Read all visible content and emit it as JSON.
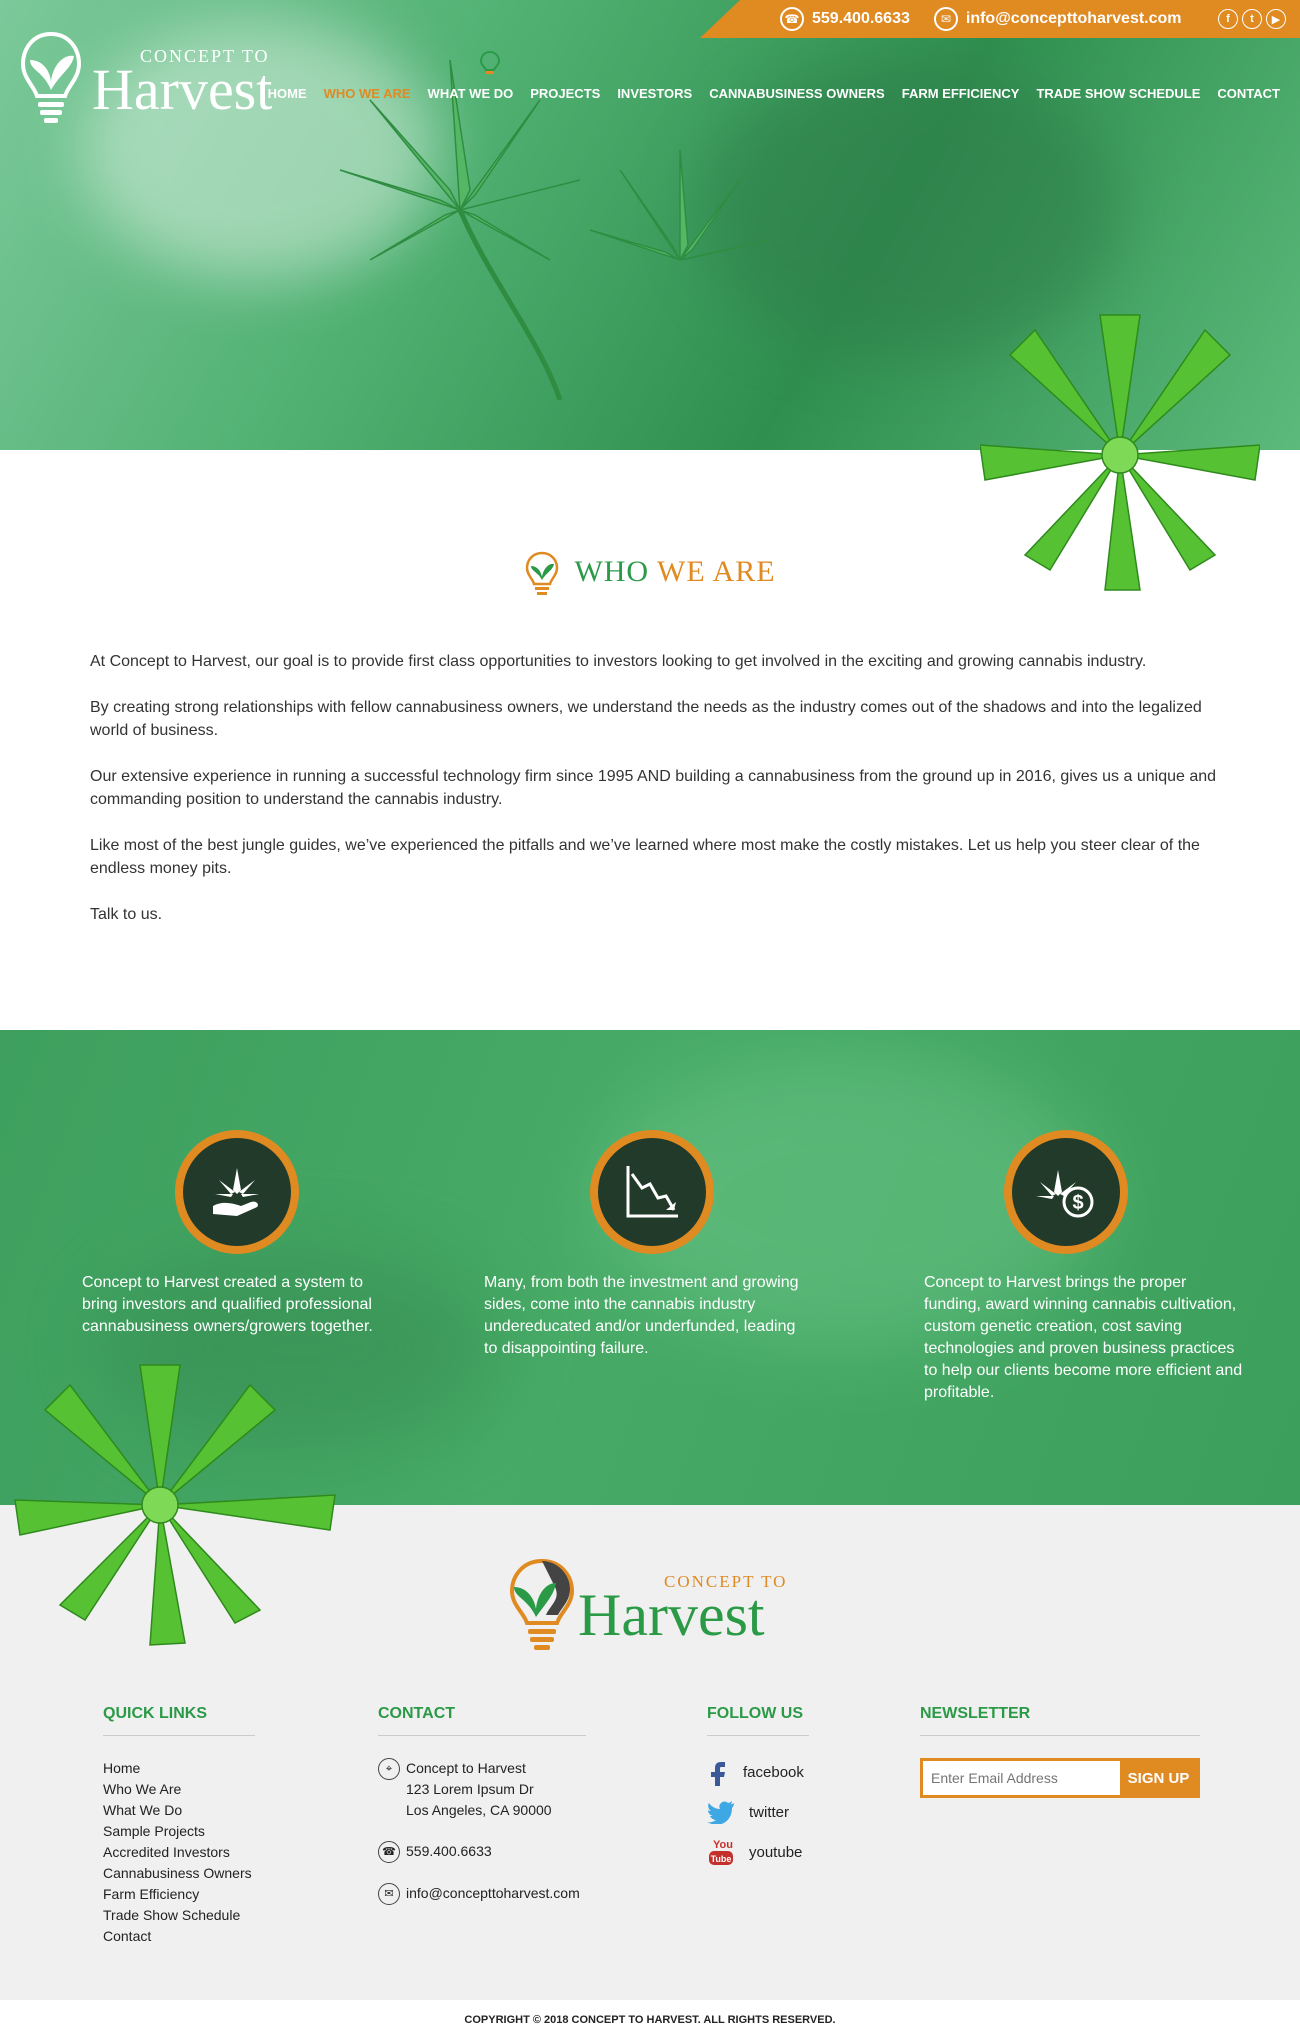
{
  "topbar": {
    "phone": "559.400.6633",
    "email": "info@concepttoharvest.com",
    "social_icons": [
      "facebook-icon",
      "twitter-icon",
      "youtube-icon"
    ]
  },
  "brand": {
    "small": "CONCEPT TO",
    "big": "Harvest"
  },
  "nav": {
    "items": [
      {
        "label": "HOME"
      },
      {
        "label": "WHO WE ARE"
      },
      {
        "label": "WHAT WE DO"
      },
      {
        "label": "PROJECTS"
      },
      {
        "label": "INVESTORS"
      },
      {
        "label": "CANNABUSINESS OWNERS"
      },
      {
        "label": "FARM EFFICIENCY"
      },
      {
        "label": "TRADE SHOW SCHEDULE"
      },
      {
        "label": "CONTACT"
      }
    ],
    "active_index": 1
  },
  "about": {
    "title_a": "WHO ",
    "title_b": "WE ARE",
    "paragraphs": [
      "At Concept to Harvest, our goal is to provide first class opportunities to investors looking to get involved in the exciting and growing cannabis industry.",
      "By creating strong relationships with fellow cannabusiness owners, we understand the needs as the industry comes out of the shadows and into the legalized world of business.",
      "Our extensive experience in running a successful technology firm since 1995 AND building a cannabusiness from the ground up in 2016, gives us a unique and commanding position to understand the cannabis industry.",
      "Like most of the best jungle guides, we’ve experienced the pitfalls and we’ve learned where most make the costly mistakes. Let us help you steer clear of the endless money pits.",
      "Talk to us."
    ]
  },
  "features": [
    {
      "icon": "hand-leaf-icon",
      "text": "Concept to Harvest created a system to bring investors and qualified professional cannabusiness owners/growers together."
    },
    {
      "icon": "declining-chart-icon",
      "text": "Many, from both the investment and growing sides, come into the cannabis industry undereducated and/or underfunded, leading to disappointing failure."
    },
    {
      "icon": "leaf-dollar-icon",
      "text": "Concept to Harvest brings the proper funding, award winning cannabis cultivation, custom genetic creation, cost saving technologies and proven business practices to help our clients become more efficient and profitable."
    }
  ],
  "footer": {
    "quick_links_title": "QUICK LINKS",
    "quick_links": [
      "Home",
      "Who We Are",
      "What We Do",
      "Sample Projects",
      "Accredited Investors",
      "Cannabusiness Owners",
      "Farm Efficiency",
      "Trade Show Schedule",
      "Contact"
    ],
    "contact_title": "CONTACT",
    "address_name": "Concept to Harvest",
    "address_line1": "123 Lorem Ipsum Dr",
    "address_line2": "Los Angeles, CA 90000",
    "phone": "559.400.6633",
    "email": "info@concepttoharvest.com",
    "follow_title": "FOLLOW US",
    "follow": [
      {
        "icon": "facebook-icon",
        "label": "facebook"
      },
      {
        "icon": "twitter-icon",
        "label": "twitter"
      },
      {
        "icon": "youtube-icon",
        "label": "youtube"
      }
    ],
    "newsletter_title": "NEWSLETTER",
    "newsletter_placeholder": "Enter Email Address",
    "signup_label": "SIGN UP"
  },
  "copyright": "COPYRIGHT © 2018 CONCEPT TO HARVEST. ALL RIGHTS RESERVED.",
  "colors": {
    "orange": "#e08a22",
    "green": "#2b9a47",
    "dark": "#223a29"
  }
}
